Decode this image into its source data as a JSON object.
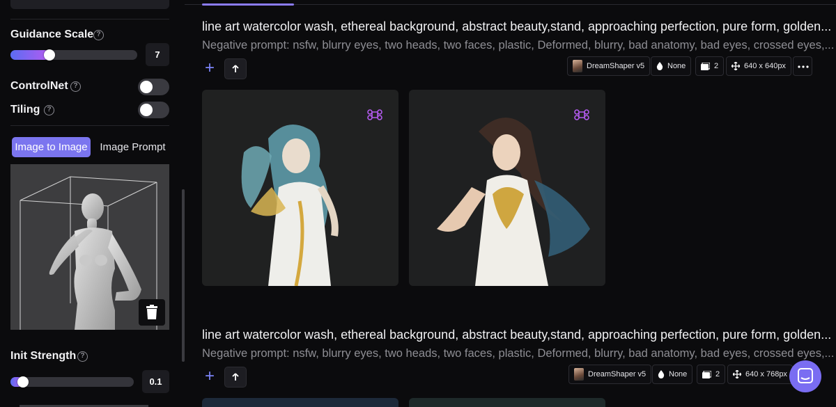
{
  "sidebar": {
    "guidance": {
      "label": "Guidance Scale",
      "value": "7",
      "fraction": 0.31
    },
    "controlnet": {
      "label": "ControlNet",
      "enabled": false
    },
    "tiling": {
      "label": "Tiling",
      "enabled": false
    },
    "tabs": {
      "active": "Image to Image",
      "inactive": "Image Prompt"
    },
    "init_strength": {
      "label": "Init Strength",
      "value": "0.1",
      "fraction": 0.1
    }
  },
  "generations": [
    {
      "prompt": "line art watercolor wash, ethereal background, abstract beauty,stand, approaching perfection, pure form, golden...",
      "negative": "Negative prompt: nsfw, blurry eyes, two heads, two faces, plastic, Deformed, blurry, bad anatomy, bad eyes, crossed eyes,...",
      "model": "DreamShaper v5",
      "style": "None",
      "count": "2",
      "size": "640 x 640px"
    },
    {
      "prompt": "line art watercolor wash, ethereal background, abstract beauty,stand, approaching perfection, pure form, golden...",
      "negative": "Negative prompt: nsfw, blurry eyes, two heads, two faces, plastic, Deformed, blurry, bad anatomy, bad eyes, crossed eyes,...",
      "model": "DreamShaper v5",
      "style": "None",
      "count": "2",
      "size": "640 x 768px"
    }
  ],
  "colors": {
    "accent": "#7b75ef",
    "slider_gradient_start": "#5b6cf3",
    "slider_gradient_end": "#b35cf0",
    "background": "#0b0b0d"
  },
  "icons": {
    "help": "question-circle-icon",
    "trash": "trash-icon",
    "plus": "plus-icon",
    "upload": "arrow-up-icon",
    "style": "drop-icon",
    "count": "images-icon",
    "size": "move-arrows-icon",
    "more": "ellipsis-icon",
    "card_badge": "command-icon",
    "support": "chat-icon"
  }
}
